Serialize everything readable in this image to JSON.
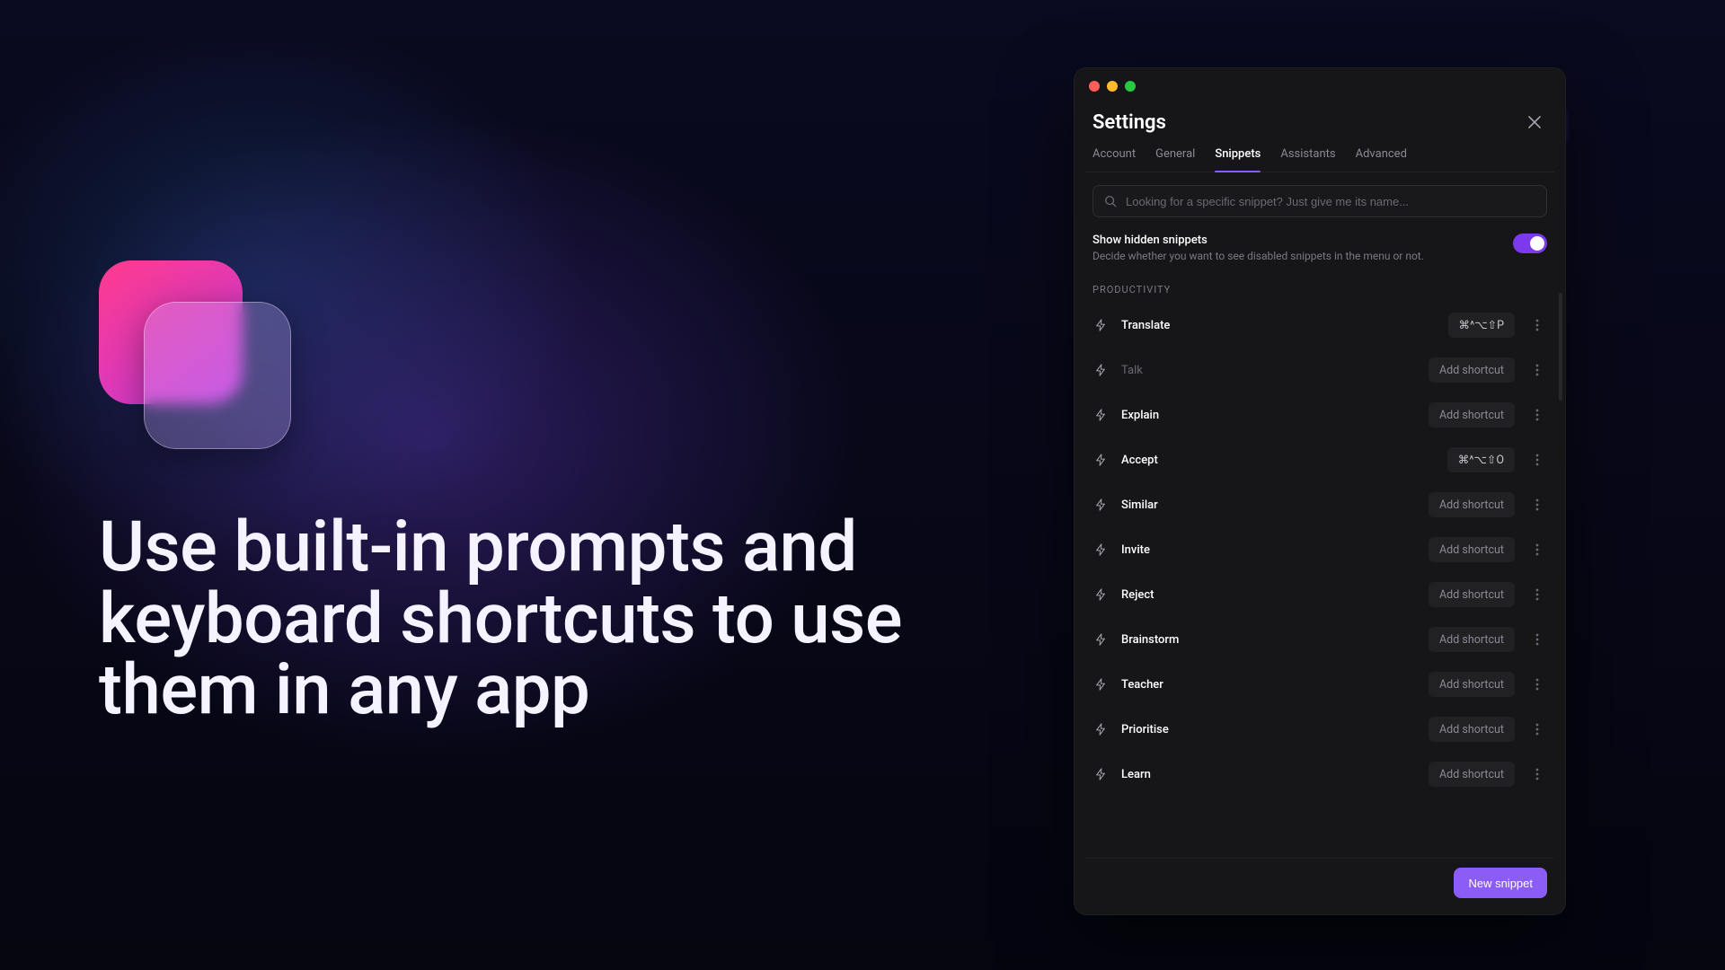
{
  "marketing": {
    "headline": "Use built-in prompts and keyboard shortcuts to use them in any app"
  },
  "window": {
    "title": "Settings",
    "tabs": [
      {
        "label": "Account",
        "active": false
      },
      {
        "label": "General",
        "active": false
      },
      {
        "label": "Snippets",
        "active": true
      },
      {
        "label": "Assistants",
        "active": false
      },
      {
        "label": "Advanced",
        "active": false
      }
    ],
    "search": {
      "placeholder": "Looking for a specific snippet? Just give me its name..."
    },
    "toggle": {
      "title": "Show hidden snippets",
      "desc": "Decide whether you want to see disabled snippets in the menu or not.",
      "on": true
    },
    "section_label": "PRODUCTIVITY",
    "add_shortcut_label": "Add shortcut",
    "snippets": [
      {
        "name": "Translate",
        "shortcut": "⌘^⌥⇧P",
        "dim": false
      },
      {
        "name": "Talk",
        "shortcut": null,
        "dim": true
      },
      {
        "name": "Explain",
        "shortcut": null,
        "dim": false
      },
      {
        "name": "Accept",
        "shortcut": "⌘^⌥⇧O",
        "dim": false
      },
      {
        "name": "Similar",
        "shortcut": null,
        "dim": false
      },
      {
        "name": "Invite",
        "shortcut": null,
        "dim": false
      },
      {
        "name": "Reject",
        "shortcut": null,
        "dim": false
      },
      {
        "name": "Brainstorm",
        "shortcut": null,
        "dim": false
      },
      {
        "name": "Teacher",
        "shortcut": null,
        "dim": false
      },
      {
        "name": "Prioritise",
        "shortcut": null,
        "dim": false
      },
      {
        "name": "Learn",
        "shortcut": null,
        "dim": false
      }
    ],
    "footer_button": "New snippet"
  }
}
